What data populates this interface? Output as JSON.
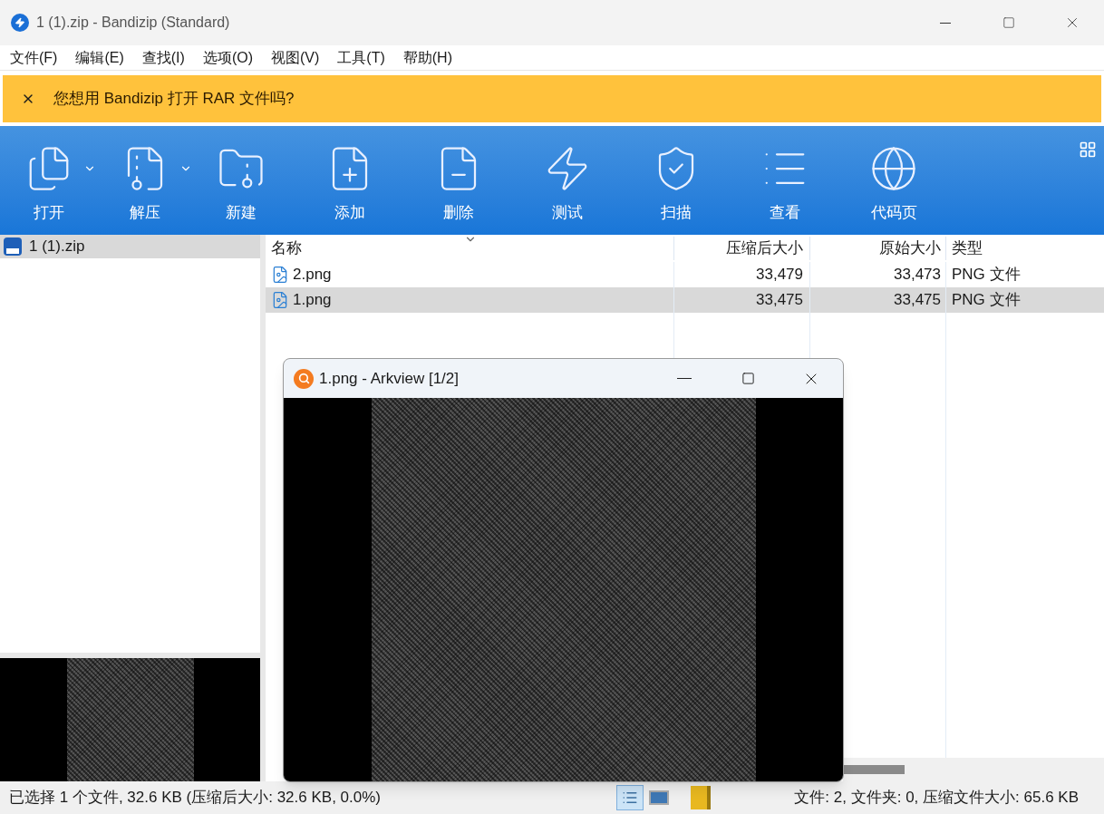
{
  "window": {
    "title": "1 (1).zip - Bandizip (Standard)"
  },
  "menu": [
    "文件(F)",
    "编辑(E)",
    "查找(I)",
    "选项(O)",
    "视图(V)",
    "工具(T)",
    "帮助(H)"
  ],
  "banner": {
    "text": "您想用 Bandizip 打开 RAR 文件吗?"
  },
  "toolbar": [
    {
      "label": "打开",
      "kind": "open",
      "has_menu": true
    },
    {
      "label": "解压",
      "kind": "extract",
      "has_menu": true
    },
    {
      "label": "新建",
      "kind": "new",
      "has_menu": false
    },
    {
      "label": "添加",
      "kind": "add",
      "has_menu": false
    },
    {
      "label": "删除",
      "kind": "delete",
      "has_menu": false
    },
    {
      "label": "测试",
      "kind": "test",
      "has_menu": false
    },
    {
      "label": "扫描",
      "kind": "scan",
      "has_menu": false
    },
    {
      "label": "查看",
      "kind": "view",
      "has_menu": false
    },
    {
      "label": "代码页",
      "kind": "codepage",
      "has_menu": false
    }
  ],
  "tree": [
    {
      "label": "1 (1).zip",
      "selected": true
    }
  ],
  "columns": [
    "名称",
    "压缩后大小",
    "原始大小",
    "类型"
  ],
  "rows": [
    {
      "name": "2.png",
      "compressed": "33,479",
      "original": "33,473",
      "type": "PNG 文件",
      "selected": false
    },
    {
      "name": "1.png",
      "compressed": "33,475",
      "original": "33,475",
      "type": "PNG 文件",
      "selected": true
    }
  ],
  "viewer": {
    "title": "1.png - Arkview [1/2]"
  },
  "status": {
    "left": "已选择 1 个文件, 32.6 KB (压缩后大小: 32.6 KB, 0.0%)",
    "right": "文件: 2, 文件夹: 0, 压缩文件大小: 65.6 KB"
  }
}
